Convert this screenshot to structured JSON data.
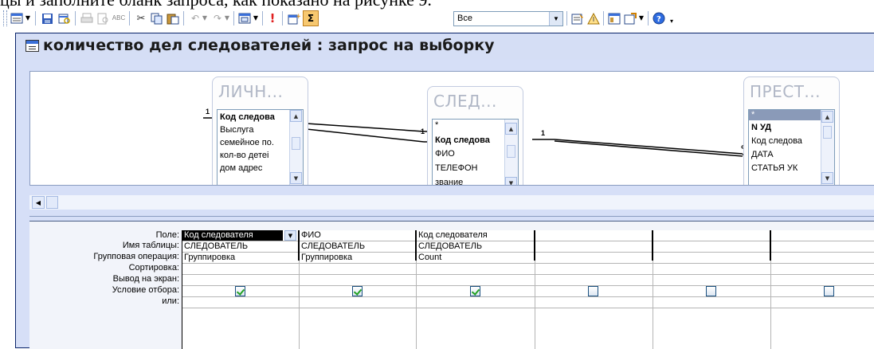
{
  "document_text": "цы и заполните бланк запроса, как показано на рисунке 9.",
  "toolbar": {
    "icons": [
      "view-icon",
      "save-icon",
      "search-table-icon",
      "print-icon",
      "print-preview-icon",
      "spelling-icon",
      "cut-icon",
      "copy-icon",
      "paste-icon",
      "undo-icon",
      "redo-icon",
      "query-type-icon",
      "run-icon",
      "show-table-icon",
      "totals-icon",
      "properties-icon",
      "build-icon",
      "database-window-icon",
      "new-object-icon",
      "help-icon"
    ],
    "top_values_value": "Все"
  },
  "window": {
    "title": "количество дел следователей : запрос на выборку"
  },
  "tables": [
    {
      "name": "ЛИЧН...",
      "fields": [
        "Код следова",
        "Выслуга",
        "семейное по.",
        "кол-во детеі",
        "дом адрес"
      ],
      "bold_index": 0
    },
    {
      "name": "СЛЕД...",
      "fields": [
        "*",
        "Код следова",
        "ФИО",
        "ТЕЛЕФОН",
        "звание"
      ],
      "bold_index": 1
    },
    {
      "name": "ПРЕСТ...",
      "fields": [
        "*",
        "N УД",
        "Код следова",
        "ДАТА",
        "СТАТЬЯ УК"
      ],
      "bold_index": 1
    }
  ],
  "relations": [
    {
      "from_label": "1",
      "to_label": "1"
    },
    {
      "from_label": "1",
      "to_label": "∞"
    }
  ],
  "grid": {
    "row_labels": [
      "Поле:",
      "Имя таблицы:",
      "Групповая операция:",
      "Сортировка:",
      "Вывод на экран:",
      "Условие отбора:",
      "или:"
    ],
    "columns": [
      {
        "field": "Код следователя",
        "table": "СЛЕДОВАТЕЛЬ",
        "total": "Группировка",
        "sort": "",
        "show": true
      },
      {
        "field": "ФИО",
        "table": "СЛЕДОВАТЕЛЬ",
        "total": "Группировка",
        "sort": "",
        "show": true
      },
      {
        "field": "Код следователя",
        "table": "СЛЕДОВАТЕЛЬ",
        "total": "Count",
        "sort": "",
        "show": true
      },
      {
        "field": "",
        "table": "",
        "total": "",
        "sort": "",
        "show": false
      },
      {
        "field": "",
        "table": "",
        "total": "",
        "sort": "",
        "show": false
      },
      {
        "field": "",
        "table": "",
        "total": "",
        "sort": "",
        "show": false
      }
    ]
  }
}
